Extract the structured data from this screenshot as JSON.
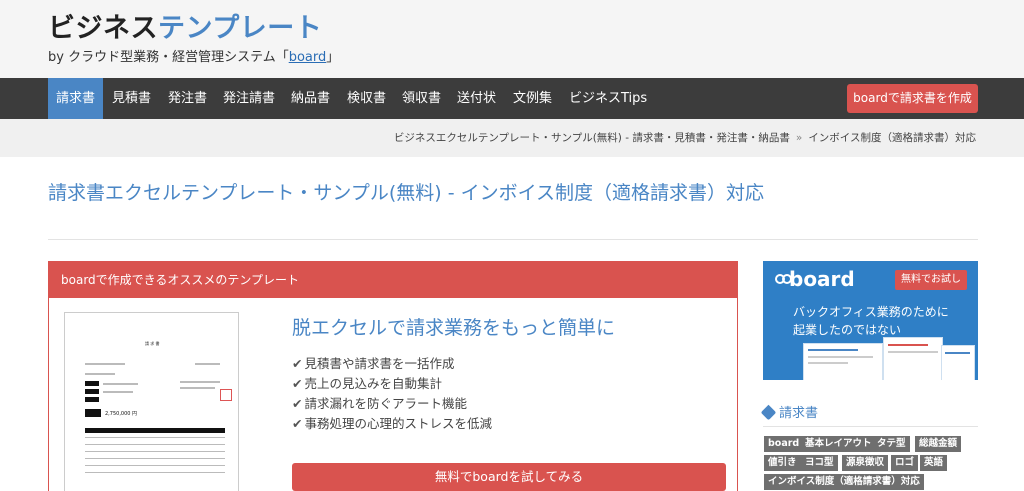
{
  "site": {
    "logo_part1": "ビジネス",
    "logo_part2": "テンプレート",
    "tagline_prefix": "by クラウド型業務・経営管理システム「",
    "tagline_link": "board",
    "tagline_suffix": "」"
  },
  "nav": {
    "items": [
      {
        "label": "請求書",
        "active": true
      },
      {
        "label": "見積書"
      },
      {
        "label": "発注書"
      },
      {
        "label": "発注請書"
      },
      {
        "label": "納品書"
      },
      {
        "label": "検収書"
      },
      {
        "label": "領収書"
      },
      {
        "label": "送付状"
      },
      {
        "label": "文例集"
      },
      {
        "label": "ビジネスTips"
      }
    ],
    "cta": "boardで請求書を作成"
  },
  "breadcrumb": {
    "parent": "ビジネスエクセルテンプレート・サンプル(無料) - 請求書・見積書・発注書・納品書",
    "separator": "»",
    "current": "インボイス制度（適格請求書）対応"
  },
  "page": {
    "title": "請求書エクセルテンプレート・サンプル(無料) - インボイス制度（適格請求書）対応"
  },
  "recommend": {
    "header": "boardで作成できるオススメのテンプレート",
    "doc_title": "請 求 書",
    "doc_amount": "2,750,000 円",
    "headline": "脱エクセルで請求業務をもっと簡単に",
    "features": [
      "見積書や請求書を一括作成",
      "売上の見込みを自動集計",
      "請求漏れを防ぐアラート機能",
      "事務処理の心理的ストレスを低減"
    ],
    "button": "無料でboardを試してみる"
  },
  "ad": {
    "logo": "board",
    "trial": "無料でお試し",
    "copy_line1": "バックオフィス業務のために",
    "copy_line2": "起業したのではない"
  },
  "category": {
    "title": "請求書",
    "tags": [
      "board",
      "基本レイアウト",
      "タテ型",
      "総越金額",
      "値引き",
      "ヨコ型",
      "源泉徴収",
      "ロゴ",
      "英語",
      "インボイス制度（適格請求書）対応"
    ]
  },
  "colors": {
    "accent_blue": "#4a86c5",
    "accent_red": "#d9534f",
    "nav_bg": "#3c3c3c"
  }
}
